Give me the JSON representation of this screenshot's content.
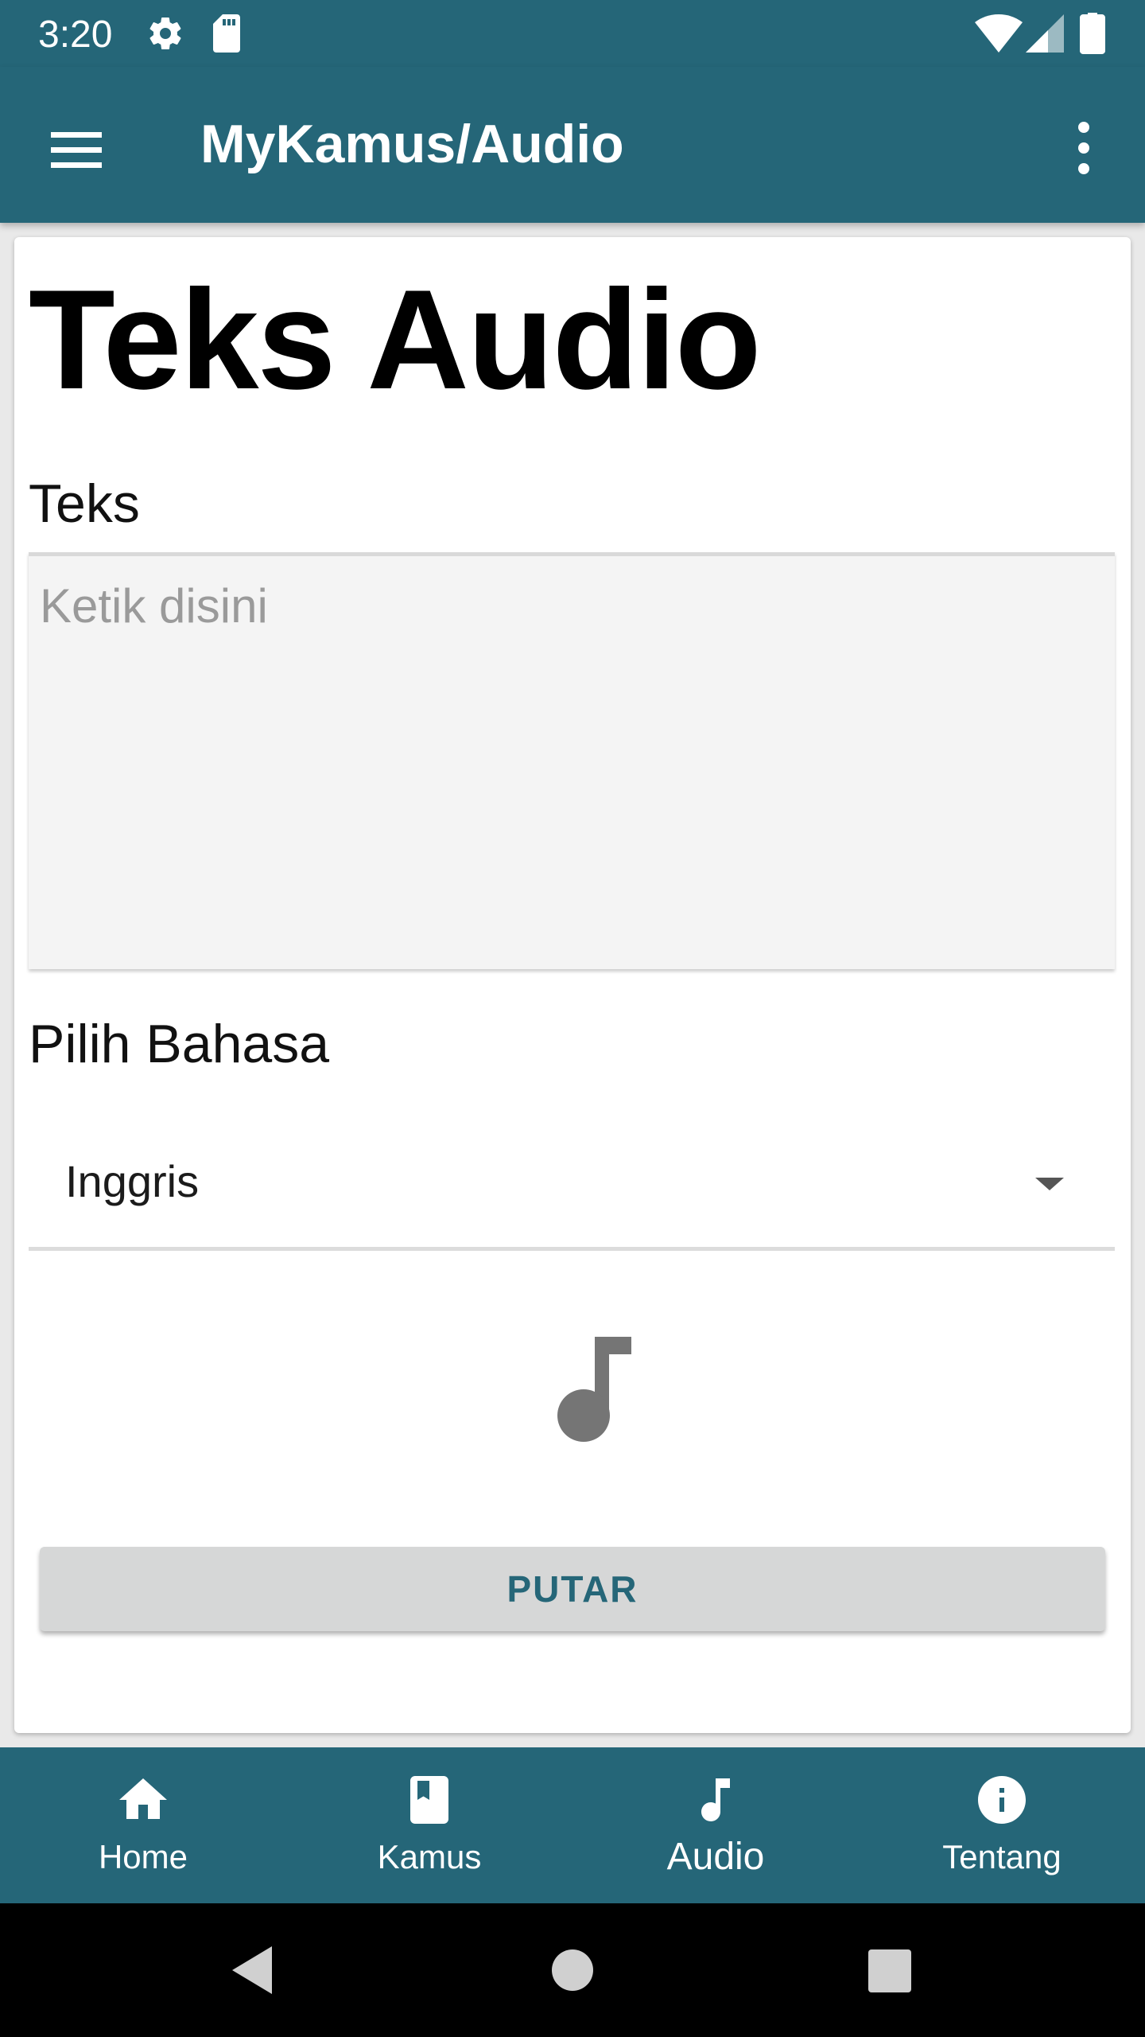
{
  "status_bar": {
    "time": "3:20"
  },
  "app_bar": {
    "title": "MyKamus/Audio"
  },
  "page": {
    "heading": "Teks Audio",
    "text_label": "Teks",
    "text_placeholder": "Ketik disini",
    "language_label": "Pilih Bahasa",
    "language_selected": "Inggris",
    "play_button": "PUTAR"
  },
  "bottom_nav": {
    "items": [
      {
        "label": "Home",
        "icon": "home-icon"
      },
      {
        "label": "Kamus",
        "icon": "book-icon"
      },
      {
        "label": "Audio",
        "icon": "music-note-icon",
        "active": true
      },
      {
        "label": "Tentang",
        "icon": "info-icon"
      }
    ]
  },
  "colors": {
    "primary": "#256678",
    "surface": "#ffffff",
    "button": "#d6d7d7"
  }
}
